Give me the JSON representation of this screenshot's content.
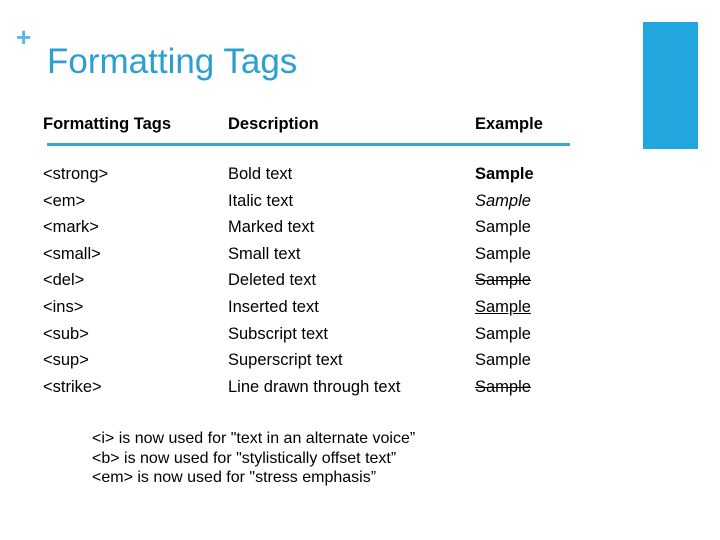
{
  "slide": {
    "plus_symbol": "+",
    "title": "Formatting Tags",
    "colors": {
      "title": "#2b9fd1",
      "accent_bar": "#22a6de",
      "rule": "#3aa8c8"
    }
  },
  "table": {
    "headers": [
      "Formatting Tags",
      "Description",
      "Example"
    ],
    "rows": [
      {
        "tag": "<strong>",
        "description": "Bold text",
        "example": "Sample",
        "example_style": "bold"
      },
      {
        "tag": "<em>",
        "description": "Italic text",
        "example": "Sample",
        "example_style": "italic"
      },
      {
        "tag": "<mark>",
        "description": "Marked  text",
        "example": "Sample",
        "example_style": "normal"
      },
      {
        "tag": "<small>",
        "description": "Small text",
        "example": "Sample",
        "example_style": "normal"
      },
      {
        "tag": "<del>",
        "description": "Deleted text",
        "example": "Sample",
        "example_style": "strikethrough"
      },
      {
        "tag": "<ins>",
        "description": "Inserted text",
        "example": "Sample",
        "example_style": "underline"
      },
      {
        "tag": "<sub>",
        "description": "Subscript  text",
        "example": "Sample",
        "example_style": "normal"
      },
      {
        "tag": "<sup>",
        "description": "Superscript text",
        "example": "Sample",
        "example_style": "normal"
      },
      {
        "tag": "<strike>",
        "description": "Line drawn through text",
        "example": "Sample",
        "example_style": "strikethrough"
      }
    ]
  },
  "notes": [
    "<i> is now used for \"text in an alternate voice”",
    "<b> is now used for \"stylistically offset text”",
    "<em> is now used for \"stress emphasis”"
  ]
}
